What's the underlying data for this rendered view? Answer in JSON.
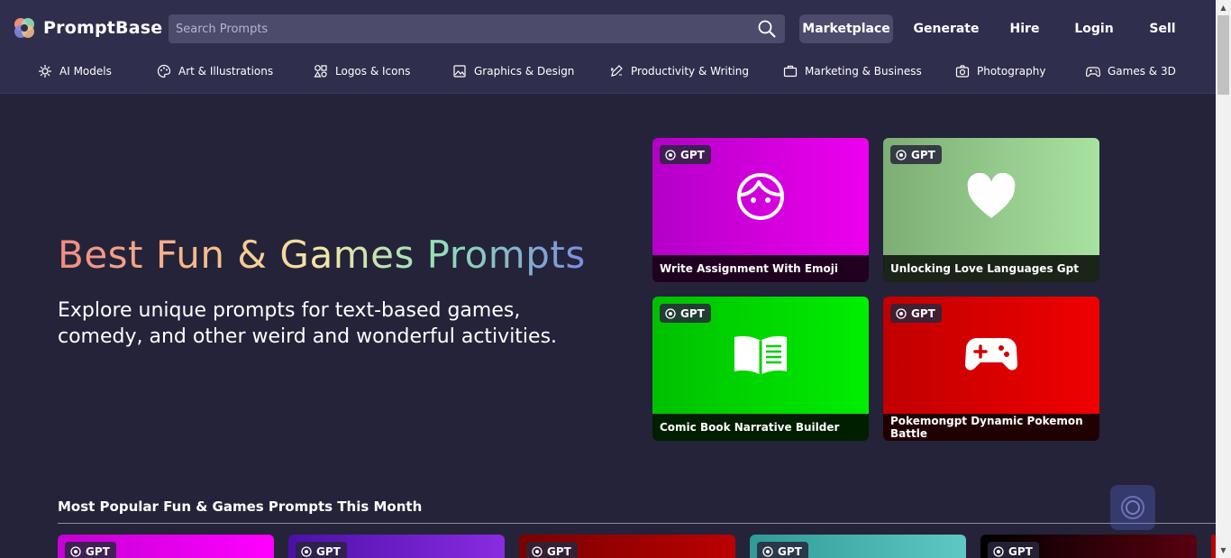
{
  "header": {
    "logo_text": "PromptBase",
    "search_placeholder": "Search Prompts",
    "nav": {
      "marketplace": "Marketplace",
      "generate": "Generate",
      "hire": "Hire",
      "login": "Login",
      "sell": "Sell"
    }
  },
  "categories": [
    {
      "label": "AI Models",
      "icon": "ai-models-icon"
    },
    {
      "label": "Art & Illustrations",
      "icon": "palette-icon"
    },
    {
      "label": "Logos & Icons",
      "icon": "shapes-icon"
    },
    {
      "label": "Graphics & Design",
      "icon": "image-icon"
    },
    {
      "label": "Productivity & Writing",
      "icon": "pen-icon"
    },
    {
      "label": "Marketing & Business",
      "icon": "briefcase-icon"
    },
    {
      "label": "Photography",
      "icon": "camera-icon"
    },
    {
      "label": "Games & 3D",
      "icon": "gamepad-icon"
    }
  ],
  "hero": {
    "title": "Best Fun & Games Prompts",
    "subtitle": "Explore unique prompts for text-based games, comedy, and other weird and wonderful activities."
  },
  "featured": [
    {
      "badge": "GPT",
      "title": "Write Assignment With Emoji",
      "icon": "face-icon",
      "colors": [
        "#b400c8",
        "#ee00ee"
      ]
    },
    {
      "badge": "GPT",
      "title": "Unlocking Love Languages Gpt",
      "icon": "heart-icon",
      "colors": [
        "#7dae74",
        "#a8e2a0"
      ]
    },
    {
      "badge": "GPT",
      "title": "Comic Book Narrative Builder",
      "icon": "book-icon",
      "colors": [
        "#00c000",
        "#00ee00"
      ]
    },
    {
      "badge": "GPT",
      "title": "Pokemongpt Dynamic Pokemon Battle",
      "icon": "gamepad-icon",
      "colors": [
        "#c00000",
        "#f00000"
      ]
    }
  ],
  "popular": {
    "title": "Most Popular Fun & Games Prompts This Month",
    "cards": [
      {
        "badge": "GPT",
        "colors": [
          "#c400d4",
          "#ff00ff"
        ]
      },
      {
        "badge": "GPT",
        "colors": [
          "#4b10a8",
          "#8a2be2"
        ]
      },
      {
        "badge": "GPT",
        "colors": [
          "#7a0000",
          "#bb0000"
        ]
      },
      {
        "badge": "GPT",
        "colors": [
          "#2f9a96",
          "#5ec8c4"
        ]
      },
      {
        "badge": "GPT",
        "colors": [
          "#000000",
          "#5a0010"
        ]
      }
    ]
  }
}
